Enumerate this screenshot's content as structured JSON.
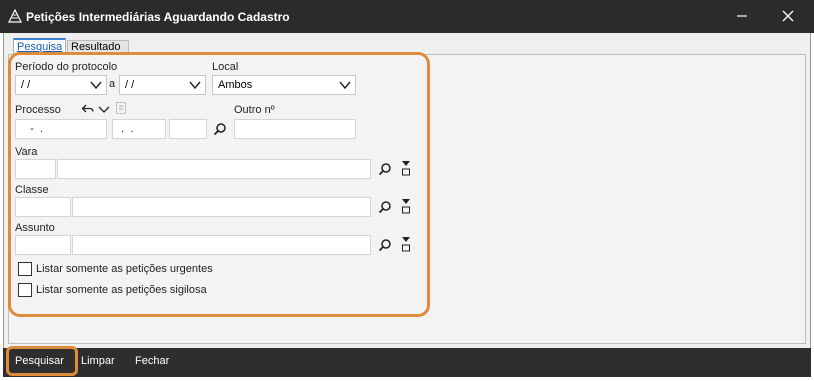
{
  "window": {
    "title": "Petições Intermediárias Aguardando Cadastro",
    "app_icon": "triangle-logo-icon",
    "minimize_icon": "minimize-icon",
    "close_icon": "close-icon"
  },
  "tabs": [
    {
      "label": "Pesquisa",
      "active": true
    },
    {
      "label": "Resultado",
      "active": false
    }
  ],
  "form": {
    "periodo_label": "Período do protocolo",
    "periodo_start": " / /",
    "periodo_separator": "a",
    "periodo_end": " / /",
    "local_label": "Local",
    "local_value": "Ambos",
    "processo_label": "Processo",
    "processo_part1": "   -  .",
    "processo_part2": " .  .",
    "processo_part3": "",
    "outro_label": "Outro nº",
    "outro_value": "",
    "vara_label": "Vara",
    "classe_label": "Classe",
    "assunto_label": "Assunto",
    "urgentes_label": "Listar somente as petições urgentes",
    "sigilosa_label": "Listar somente as petições sigilosa",
    "urgentes_checked": false,
    "sigilosa_checked": false
  },
  "actions": {
    "pesquisar": "Pesquisar",
    "limpar": "Limpar",
    "fechar": "Fechar"
  },
  "colors": {
    "titlebar": "#2b2b2b",
    "highlight": "#e08a3c",
    "tab_accent": "#3a7fd0"
  }
}
